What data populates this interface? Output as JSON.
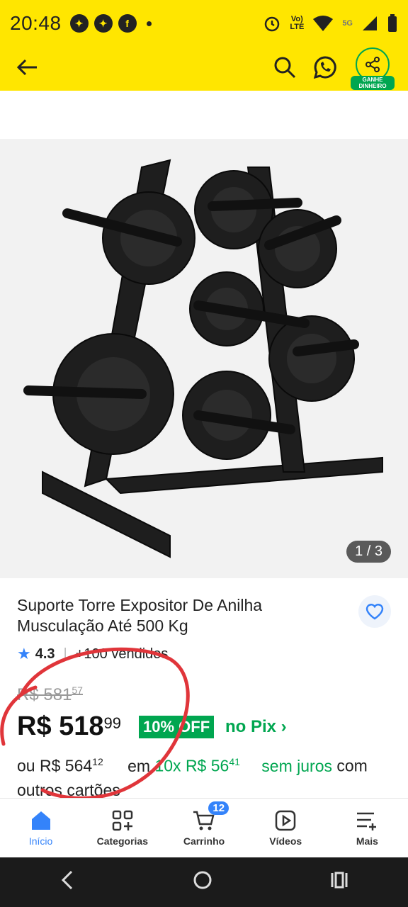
{
  "status": {
    "time": "20:48",
    "lte_label": "LTE",
    "signal_label": "5G"
  },
  "topbar": {
    "share_badge": "GANHE DINHEIRO"
  },
  "gallery": {
    "pager": "1 / 3"
  },
  "product": {
    "title": "Suporte Torre Expositor De Anilha Musculação Até 500 Kg",
    "rating": "4.3",
    "sold": "+100 vendidos",
    "old_price_main": "R$ 581",
    "old_price_cents": "57",
    "price_main": "R$ 518",
    "price_cents": "99",
    "discount": "10% OFF",
    "pix": "no Pix ›",
    "inst_prefix": "ou",
    "inst_price_main": "R$ 564",
    "inst_price_cents": "12",
    "inst_mid": "em",
    "inst_plan_main": "10x R$ 56",
    "inst_plan_cents": "41",
    "inst_suffix_green": "sem juros",
    "inst_suffix": "com outros cartões"
  },
  "nav": {
    "items": [
      {
        "label": "Início",
        "icon": "home-icon"
      },
      {
        "label": "Categorias",
        "icon": "categories-icon"
      },
      {
        "label": "Carrinho",
        "icon": "cart-icon",
        "badge": "12"
      },
      {
        "label": "Vídeos",
        "icon": "video-icon"
      },
      {
        "label": "Mais",
        "icon": "more-icon"
      }
    ]
  },
  "colors": {
    "brand_yellow": "#ffe600",
    "accent_blue": "#3483fa",
    "green": "#00a650",
    "annotation_red": "#e0353a"
  }
}
